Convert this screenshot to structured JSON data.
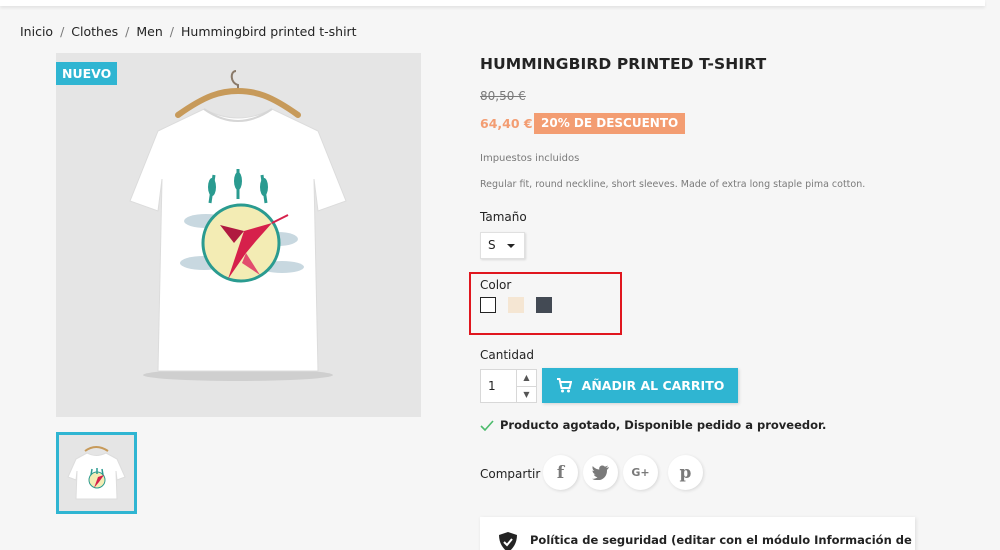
{
  "breadcrumb": [
    "Inicio",
    "Clothes",
    "Men",
    "Hummingbird printed t-shirt"
  ],
  "breadcrumb_separator": "/",
  "badge": "NUEVO",
  "product": {
    "title": "HUMMINGBIRD PRINTED T-SHIRT",
    "old_price": "80,50 €",
    "price": "64,40 €",
    "discount": "20% DE DESCUENTO",
    "tax_label": "Impuestos incluidos",
    "description": "Regular fit, round neckline, short sleeves. Made of extra long staple pima cotton."
  },
  "size": {
    "label": "Tamaño",
    "selected": "S"
  },
  "color": {
    "label": "Color",
    "swatches": [
      {
        "name": "white",
        "hex": "#ffffff",
        "selected": true
      },
      {
        "name": "cream",
        "hex": "#f5e6d3",
        "selected": false
      },
      {
        "name": "charcoal",
        "hex": "#434a54",
        "selected": false
      }
    ]
  },
  "quantity": {
    "label": "Cantidad",
    "value": "1"
  },
  "add_to_cart": "AÑADIR AL CARRITO",
  "availability": "Producto agotado, Disponible pedido a proveedor.",
  "share": {
    "label": "Compartir",
    "networks": [
      "facebook-icon",
      "twitter-icon",
      "google-plus-icon",
      "pinterest-icon"
    ]
  },
  "security": "Política de seguridad (editar con el módulo Información de",
  "colors": {
    "accent": "#2fb5d2",
    "discount": "#f39d72",
    "highlight": "#e0161e",
    "available": "#4cbb6c"
  }
}
